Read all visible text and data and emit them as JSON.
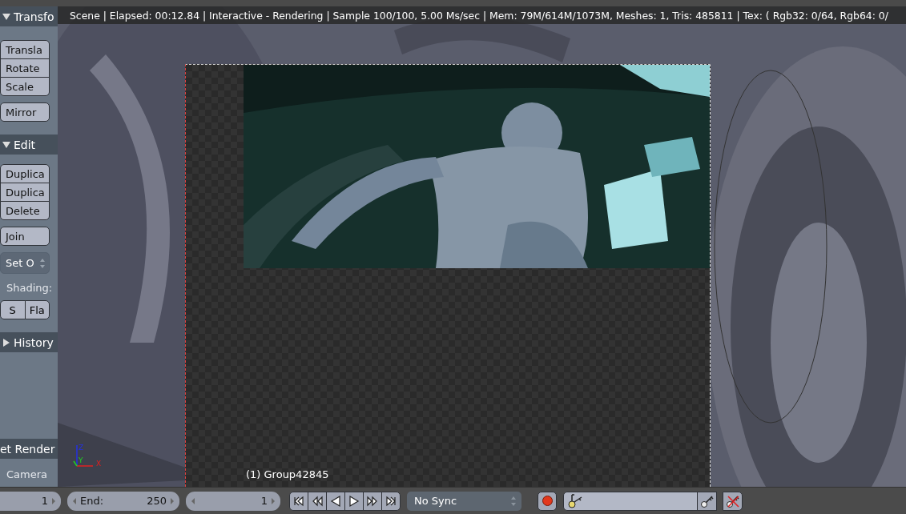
{
  "shelf": {
    "title": "Transfo",
    "expanded": true,
    "items": [
      {
        "kind": "button_group",
        "labels": [
          "Transla",
          "Rotate",
          "Scale"
        ]
      },
      {
        "kind": "button_group",
        "labels": [
          "Mirror"
        ]
      },
      {
        "kind": "panel_header",
        "label": "Edit",
        "expanded": true
      },
      {
        "kind": "button_group",
        "labels": [
          "Duplica",
          "Duplica",
          "Delete"
        ]
      },
      {
        "kind": "button_group",
        "labels": [
          "Join"
        ]
      },
      {
        "kind": "dropdown",
        "label": "Set O"
      },
      {
        "kind": "label",
        "label": "Shading:"
      },
      {
        "kind": "button_row",
        "labels": [
          "S",
          "Fla"
        ]
      },
      {
        "kind": "panel_header",
        "label": "History",
        "expanded": false
      },
      {
        "kind": "spacer"
      },
      {
        "kind": "panel_header_plain",
        "label": "et Render"
      },
      {
        "kind": "label",
        "label": "Camera"
      }
    ]
  },
  "viewport": {
    "info": "Scene | Elapsed: 00:12.84 | Interactive - Rendering | Sample 100/100, 5.00 Ms/sec | Mem: 79M/614M/1073M, Meshes: 1, Tris: 485811 | Tex: ( Rgb32: 0/64, Rgb64: 0/",
    "object_label": "(1) Group42845",
    "axes": [
      "Z",
      "Y",
      "X"
    ]
  },
  "timeline": {
    "start": "1",
    "end_label": "End:",
    "end": "250",
    "current": "1",
    "sync": "No Sync"
  }
}
